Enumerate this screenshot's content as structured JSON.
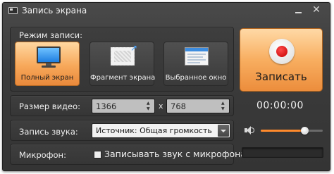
{
  "window": {
    "title": "Запись экрана",
    "minimize_icon": "minimize-icon",
    "close_icon": "close-icon",
    "close_glyph": "✕"
  },
  "mode": {
    "label": "Режим записи:",
    "options": [
      {
        "label": "Полный экран",
        "icon": "monitor-icon",
        "selected": true
      },
      {
        "label": "Фрагмент экрана",
        "icon": "screen-fragment-icon",
        "selected": false
      },
      {
        "label": "Выбранное окно",
        "icon": "window-icon",
        "selected": false
      }
    ]
  },
  "record": {
    "label": "Записать",
    "icon": "record-icon"
  },
  "video_size": {
    "label": "Размер видео:",
    "width": "1366",
    "height": "768",
    "separator": "x"
  },
  "timer": "00:00:00",
  "sound": {
    "label": "Запись звука:",
    "source": "Источник: Общая громкость",
    "volume_level": 0.7
  },
  "microphone": {
    "label": "Микрофон:",
    "checkbox_label": "Записывать звук с микрофона",
    "checked": false
  },
  "colors": {
    "accent": "#f8ae60",
    "record_red": "#d40000",
    "slider_fill": "#ff8a2c",
    "background": "#3b3b3b"
  }
}
